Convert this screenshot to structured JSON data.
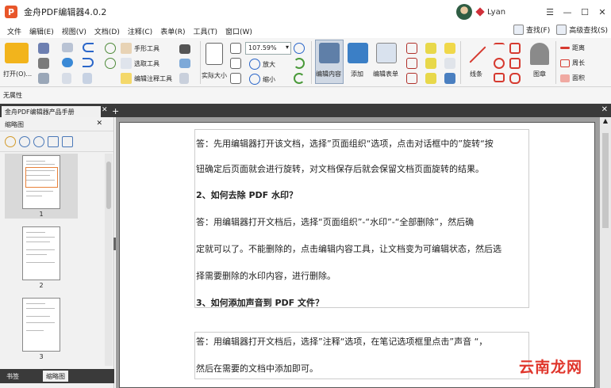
{
  "window": {
    "title": "金舟PDF编辑器4.0.2",
    "logo_letter": "P",
    "user": "Lyan",
    "controls": [
      "☰",
      "—",
      "☐",
      "✕"
    ]
  },
  "menu": [
    "文件",
    "编辑(E)",
    "视图(V)",
    "文档(D)",
    "注释(C)",
    "表单(R)",
    "工具(T)",
    "窗口(W)"
  ],
  "menu_right": {
    "find": "查找(F)",
    "advanced_find": "高级查找(S)"
  },
  "toolbar": {
    "open": "打开(O)...",
    "hand_tool": "手形工具",
    "select_tool": "选取工具",
    "edit_annot_tool": "编辑注释工具",
    "actual_size": "实际大小",
    "zoom_value": "107.59%",
    "zoom_in": "放大",
    "zoom_out": "缩小",
    "edit_content": "编辑内容",
    "add": "添加",
    "edit_form": "编辑表单",
    "lines": "线条",
    "stamp": "图章",
    "distance": "距离",
    "perimeter": "周长",
    "area": "面积",
    "accent": "#2a66c9"
  },
  "properties": {
    "label": "无属性"
  },
  "tabs": {
    "document": "金舟PDF编辑器产品手册",
    "close": "✕",
    "add": "+"
  },
  "left_panel": {
    "title": "缩略图",
    "close": "✕",
    "thumbnails": [
      "1",
      "2",
      "3"
    ],
    "bottom_tabs": [
      "书签",
      "缩略图"
    ]
  },
  "document": {
    "paragraphs": [
      "答：先用编辑器打开该文档，选择”页面组织“选项，点击对话框中的”旋转“按",
      "钮确定后页面就会进行旋转，对文档保存后就会保留文档页面旋转的结果。",
      "2、如何去除 PDF 水印？",
      "答：用编辑器打开文档后，选择“页面组织”-“水印”-“全部删除”，然后确",
      "定就可以了。不能删除的，点击编辑内容工具，让文档变为可编辑状态，然后选",
      "择需要删除的水印内容，进行删除。",
      "3、如何添加声音到 PDF 文件？",
      "答：用编辑器打开文档后，选择”注释“选项，在笔记选项框里点击”声音 “，",
      "然后在需要的文档中添加即可。"
    ],
    "watermark": "云南龙网"
  }
}
